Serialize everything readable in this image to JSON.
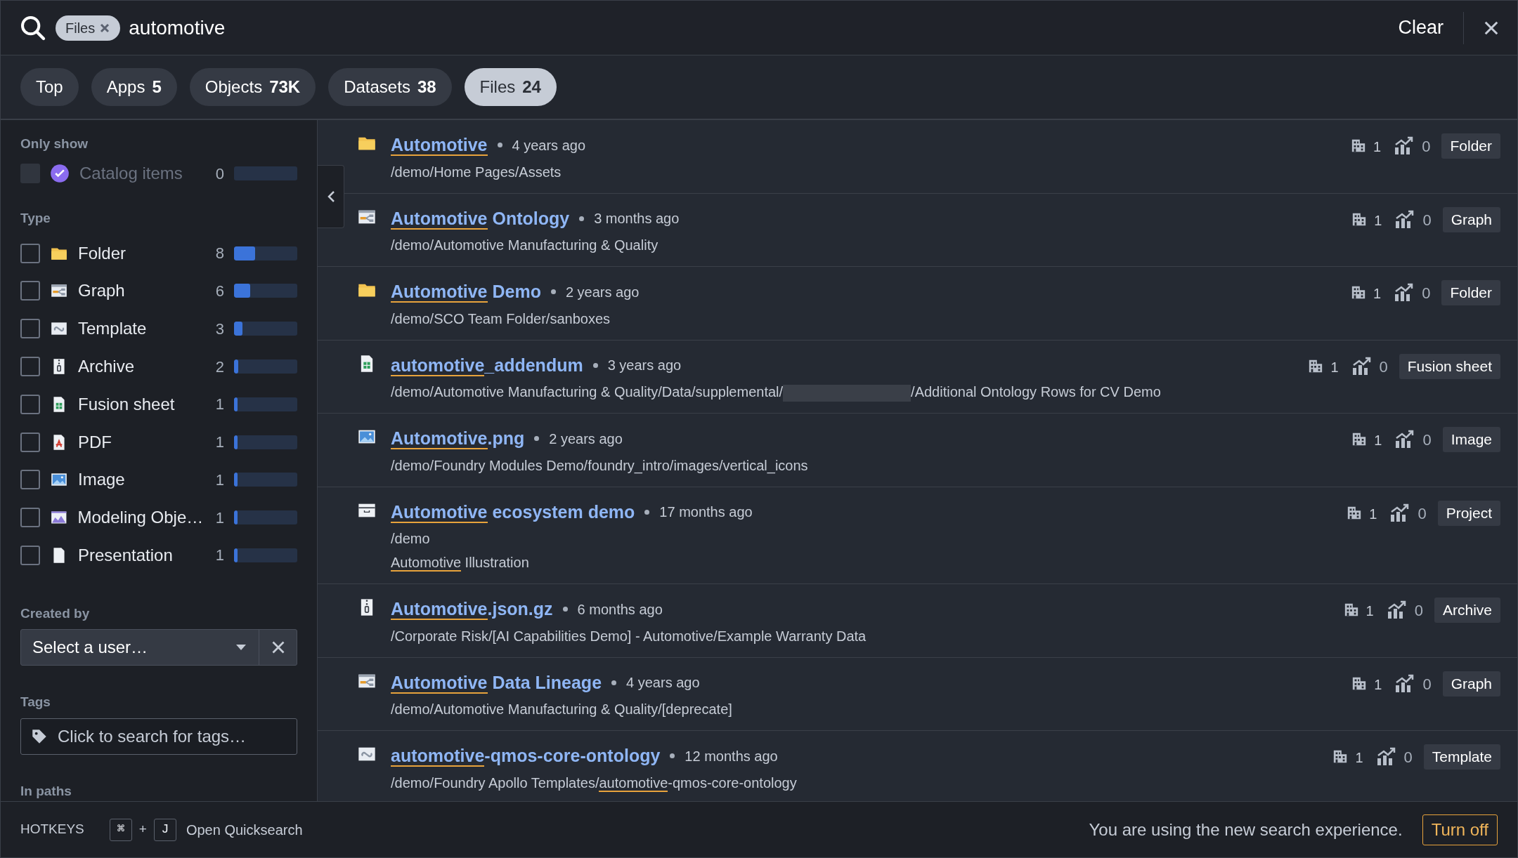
{
  "search": {
    "chip": "Files",
    "query": "automotive",
    "clear": "Clear"
  },
  "tabs": [
    {
      "label": "Top",
      "selected": false
    },
    {
      "label": "Apps",
      "count": "5",
      "selected": false
    },
    {
      "label": "Objects",
      "count": "73K",
      "selected": false
    },
    {
      "label": "Datasets",
      "count": "38",
      "selected": false
    },
    {
      "label": "Files",
      "count": "24",
      "selected": true
    }
  ],
  "filters": {
    "only_show_label": "Only show",
    "catalog": {
      "label": "Catalog items",
      "count": "0",
      "checked": false,
      "disabled": true
    },
    "type_label": "Type",
    "types": [
      {
        "kind": "folder",
        "label": "Folder",
        "count": "8",
        "level": 0.33,
        "checked": false
      },
      {
        "kind": "graph",
        "label": "Graph",
        "count": "6",
        "level": 0.25,
        "checked": false
      },
      {
        "kind": "template",
        "label": "Template",
        "count": "3",
        "level": 0.13,
        "checked": false
      },
      {
        "kind": "archive",
        "label": "Archive",
        "count": "2",
        "level": 0.07,
        "checked": false
      },
      {
        "kind": "sheet",
        "label": "Fusion sheet",
        "count": "1",
        "level": 0.03,
        "checked": false
      },
      {
        "kind": "pdf",
        "label": "PDF",
        "count": "1",
        "level": 0.03,
        "checked": false
      },
      {
        "kind": "image",
        "label": "Image",
        "count": "1",
        "level": 0.03,
        "checked": false
      },
      {
        "kind": "modeling",
        "label": "Modeling Obje…",
        "count": "1",
        "level": 0.03,
        "checked": false
      },
      {
        "kind": "presentation",
        "label": "Presentation",
        "count": "1",
        "level": 0.03,
        "checked": false
      }
    ],
    "created_by_label": "Created by",
    "user_placeholder": "Select a user…",
    "tags_label": "Tags",
    "tags_placeholder": "Click to search for tags…",
    "in_paths_label": "In paths"
  },
  "results": [
    {
      "kind": "folder",
      "title": [
        {
          "text": "Automotive",
          "match": true
        }
      ],
      "time": "4 years ago",
      "lines": [
        [
          {
            "text": "/demo/Home Pages/Assets",
            "match": false
          }
        ]
      ],
      "projects": "1",
      "usage": "0",
      "type": "Folder"
    },
    {
      "kind": "graph",
      "title": [
        {
          "text": "Automotive",
          "match": true
        },
        {
          "text": " Ontology",
          "match": false
        }
      ],
      "time": "3 months ago",
      "lines": [
        [
          {
            "text": "/demo/Automotive Manufacturing & Quality",
            "match": false
          }
        ]
      ],
      "projects": "1",
      "usage": "0",
      "type": "Graph"
    },
    {
      "kind": "folder",
      "title": [
        {
          "text": "Automotive",
          "match": true
        },
        {
          "text": " Demo",
          "match": false
        }
      ],
      "time": "2 years ago",
      "lines": [
        [
          {
            "text": "/demo/SCO Team Folder/sanboxes",
            "match": false
          }
        ]
      ],
      "projects": "1",
      "usage": "0",
      "type": "Folder"
    },
    {
      "kind": "sheet",
      "title": [
        {
          "text": "automotive",
          "match": true
        },
        {
          "text": "_addendum",
          "match": false
        }
      ],
      "time": "3 years ago",
      "lines": [
        [
          {
            "text": "/demo/Automotive Manufacturing & Quality/Data/supplemental/",
            "match": false
          },
          {
            "redacted": true
          },
          {
            "text": "/Additional Ontology Rows for CV Demo",
            "match": false
          }
        ]
      ],
      "projects": "1",
      "usage": "0",
      "type": "Fusion sheet"
    },
    {
      "kind": "image",
      "title": [
        {
          "text": "Automotive",
          "match": true
        },
        {
          "text": ".png",
          "match": false
        }
      ],
      "time": "2 years ago",
      "lines": [
        [
          {
            "text": "/demo/Foundry Modules Demo/foundry_intro/images/vertical_icons",
            "match": false
          }
        ]
      ],
      "projects": "1",
      "usage": "0",
      "type": "Image"
    },
    {
      "kind": "project",
      "title": [
        {
          "text": "Automotive",
          "match": true
        },
        {
          "text": " ecosystem demo",
          "match": false
        }
      ],
      "time": "17 months ago",
      "lines": [
        [
          {
            "text": "/demo",
            "match": false
          }
        ],
        [
          {
            "text": "Automotive",
            "match": true
          },
          {
            "text": " Illustration",
            "match": false
          }
        ]
      ],
      "projects": "1",
      "usage": "0",
      "type": "Project"
    },
    {
      "kind": "archive",
      "title": [
        {
          "text": "Automotive",
          "match": true
        },
        {
          "text": ".json.gz",
          "match": false
        }
      ],
      "time": "6 months ago",
      "lines": [
        [
          {
            "text": "/Corporate Risk/[AI Capabilities Demo] - Automotive/Example Warranty Data",
            "match": false
          }
        ]
      ],
      "projects": "1",
      "usage": "0",
      "type": "Archive"
    },
    {
      "kind": "graph",
      "title": [
        {
          "text": "Automotive",
          "match": true
        },
        {
          "text": " Data Lineage",
          "match": false
        }
      ],
      "time": "4 years ago",
      "lines": [
        [
          {
            "text": "/demo/Automotive Manufacturing & Quality/[deprecate]",
            "match": false
          }
        ]
      ],
      "projects": "1",
      "usage": "0",
      "type": "Graph"
    },
    {
      "kind": "template",
      "title": [
        {
          "text": "automotive",
          "match": true
        },
        {
          "text": "-qmos-core-ontology",
          "match": false
        }
      ],
      "time": "12 months ago",
      "lines": [
        [
          {
            "text": "/demo/Foundry Apollo Templates/",
            "match": false
          },
          {
            "text": "automotive",
            "match": true
          },
          {
            "text": "-qmos-core-ontology",
            "match": false
          }
        ]
      ],
      "projects": "1",
      "usage": "0",
      "type": "Template"
    }
  ],
  "footer": {
    "hotkeys_label": "HOTKEYS",
    "keys": [
      "⌘",
      "J"
    ],
    "plus": "+",
    "action": "Open Quicksearch",
    "message": "You are using the new search experience.",
    "turn_off": "Turn off"
  }
}
